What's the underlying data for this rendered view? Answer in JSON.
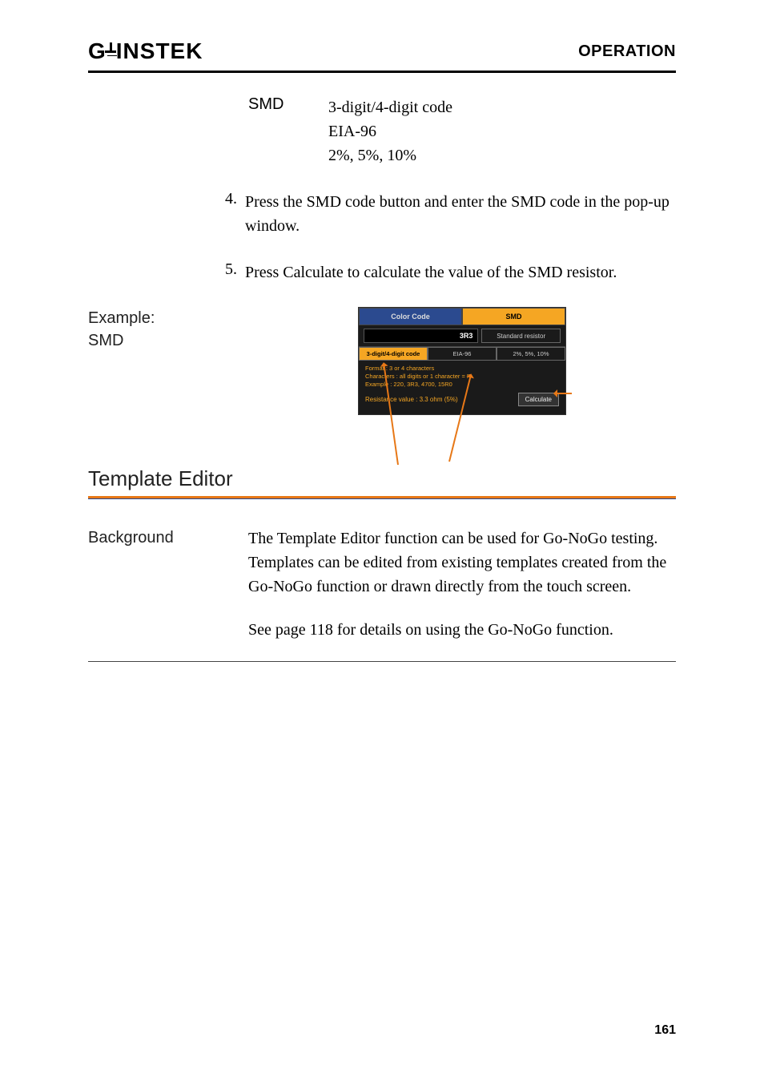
{
  "header": {
    "brand": "GWINSTEK",
    "section": "OPERATION"
  },
  "smd_block": {
    "label": "SMD",
    "line1": "3-digit/4-digit code",
    "line2": "EIA-96",
    "line3": "2%, 5%, 10%"
  },
  "steps": {
    "s4_num": "4.",
    "s4_text": "Press the SMD code button and enter the SMD code in the pop-up window.",
    "s5_num": "5.",
    "s5_text": "Press Calculate to calculate the value of the SMD resistor."
  },
  "example": {
    "label1": "Example:",
    "label2": "SMD"
  },
  "shot": {
    "tab_colorcode": "Color Code",
    "tab_smd": "SMD",
    "input_val": "3R3",
    "type_label": "Standard resistor",
    "opt1": "3-digit/4-digit code",
    "opt2": "EIA-96",
    "opt3": "2%, 5%, 10%",
    "info1": "Format : 3 or 4 characters",
    "info2": "Characters : all digits or 1 character = R",
    "info3": "Example : 220, 3R3, 4700, 15R0",
    "result": "Resistance value : 3.3 ohm (5%)",
    "calc_btn": "Calculate"
  },
  "template_section": {
    "title": "Template Editor",
    "bg_label": "Background",
    "bg_para1": "The Template Editor function can be used for Go-NoGo testing. Templates can be edited from existing templates created from the Go-NoGo function or drawn directly from the touch screen.",
    "bg_para2": "See page 118 for details on using the Go-NoGo function."
  },
  "page_number": "161"
}
